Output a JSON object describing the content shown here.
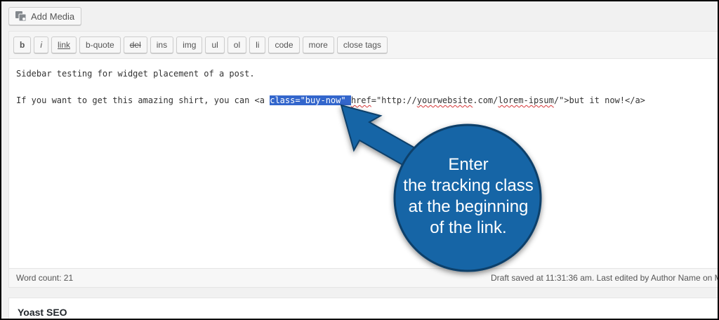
{
  "media": {
    "add_media_label": "Add Media"
  },
  "toolbar": {
    "buttons": [
      "b",
      "i",
      "link",
      "b-quote",
      "del",
      "ins",
      "img",
      "ul",
      "ol",
      "li",
      "code",
      "more",
      "close tags"
    ]
  },
  "editor": {
    "line1": "Sidebar testing for widget placement of a post.",
    "line2_prefix": "If you want to get this amazing shirt, you can <a ",
    "line2_highlight": "class=\"buy-now\" ",
    "line2_href_word": "href",
    "line2_mid": "=\"http://",
    "line2_url1": "yourwebsite",
    "line2_url2": ".com/",
    "line2_url3": "lorem-ipsum",
    "line2_suffix": "/\">but it now!</a>"
  },
  "status": {
    "word_count": "Word count: 21",
    "draft_saved": "Draft saved at 11:31:36 am. Last edited by Author Name on M"
  },
  "yoast": {
    "title": "Yoast SEO"
  },
  "callout": {
    "lines": [
      "Enter",
      "the tracking class",
      "at the beginning",
      "of the link."
    ],
    "color": "#1565a6"
  }
}
